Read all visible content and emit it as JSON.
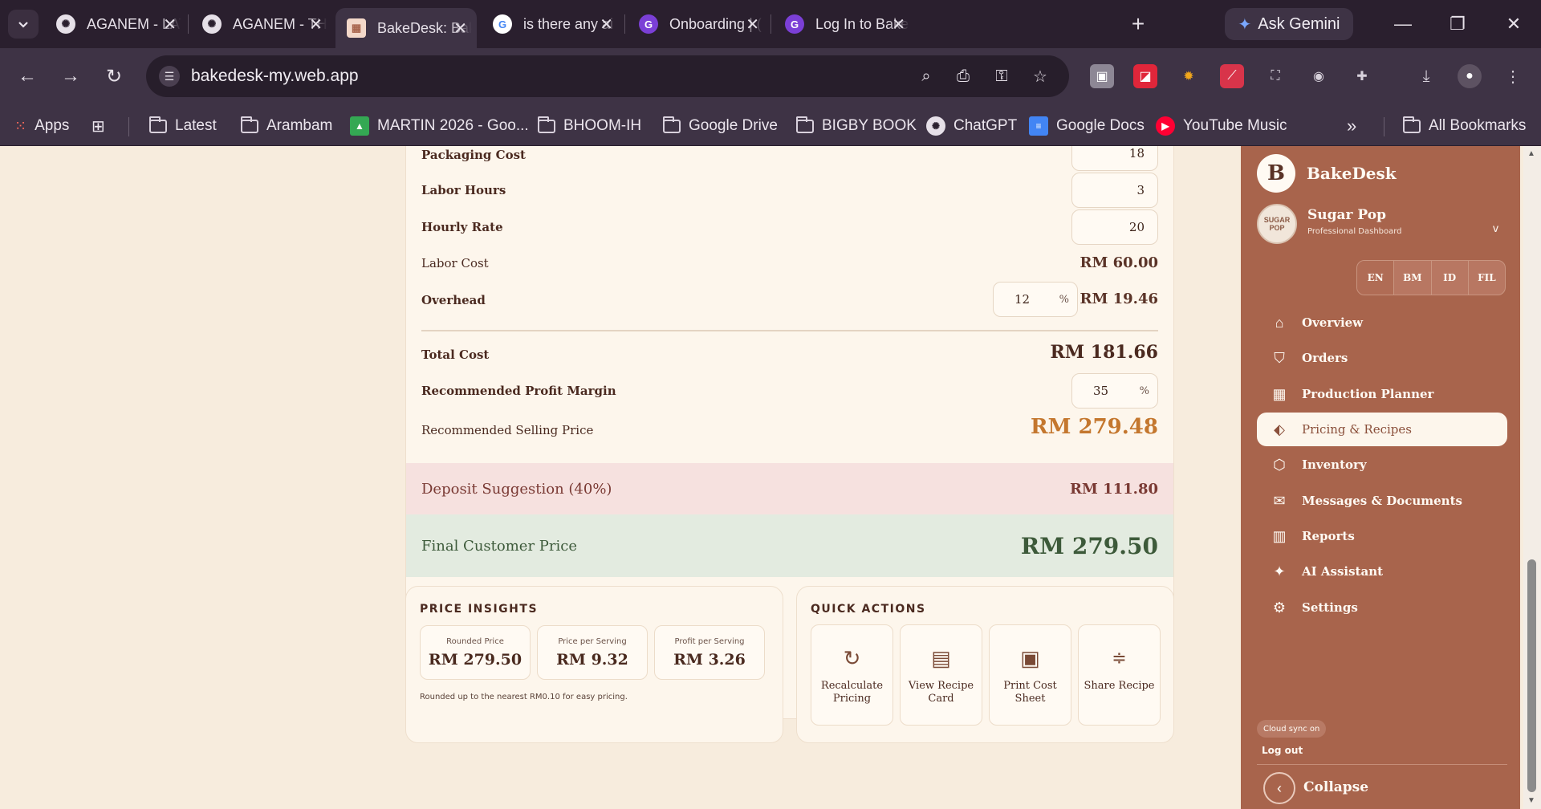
{
  "browser": {
    "tabs": [
      {
        "title": "AGANEM - LAT",
        "icon": "chatgpt-icon"
      },
      {
        "title": "AGANEM - THI",
        "icon": "chatgpt-icon"
      },
      {
        "title": "BakeDesk: Bak",
        "icon": "bakedesk-icon",
        "active": true
      },
      {
        "title": "is there any ai",
        "icon": "google-icon"
      },
      {
        "title": "Onboarding | (",
        "icon": "g-purple-icon"
      },
      {
        "title": "Log In to Bake",
        "icon": "g-purple-icon"
      }
    ],
    "ask_gemini": "Ask Gemini",
    "url": "bakedesk-my.web.app",
    "bookmarks": {
      "apps": "Apps",
      "latest": "Latest",
      "arambam": "Arambam",
      "martin": "MARTIN 2026 - Goo...",
      "bhoom": "BHOOM-IH",
      "google_drive": "Google Drive",
      "bigby": "BIGBY BOOK",
      "chatgpt": "ChatGPT",
      "google_docs": "Google Docs",
      "youtube_music": "YouTube Music",
      "more": "»",
      "all_bookmarks": "All Bookmarks"
    }
  },
  "calculator": {
    "packaging_cost": {
      "label": "Packaging Cost",
      "value": "18"
    },
    "labor_hours": {
      "label": "Labor Hours",
      "value": "3"
    },
    "hourly_rate": {
      "label": "Hourly Rate",
      "value": "20"
    },
    "labor_cost": {
      "label": "Labor Cost",
      "value": "RM 60.00"
    },
    "overhead": {
      "label": "Overhead",
      "percent": "12",
      "percent_symbol": "%",
      "value": "RM 19.46"
    },
    "total_cost": {
      "label": "Total Cost",
      "value": "RM 181.66"
    },
    "profit_margin": {
      "label": "Recommended Profit Margin",
      "percent": "35",
      "percent_symbol": "%"
    },
    "selling_price": {
      "label": "Recommended Selling Price",
      "value": "RM 279.48"
    },
    "deposit": {
      "label": "Deposit Suggestion (40%)",
      "value": "RM 111.80"
    },
    "final_price": {
      "label": "Final Customer Price",
      "value": "RM 279.50"
    }
  },
  "insights": {
    "title": "PRICE INSIGHTS",
    "rounded": {
      "caption": "Rounded Price",
      "value": "RM 279.50"
    },
    "per_serving": {
      "caption": "Price per Serving",
      "value": "RM 9.32"
    },
    "profit_serving": {
      "caption": "Profit per Serving",
      "value": "RM 3.26"
    },
    "note": "Rounded up to the nearest RM0.10 for easy pricing."
  },
  "quick_actions": {
    "title": "QUICK ACTIONS",
    "recalculate": "Recalculate Pricing",
    "view_card": "View Recipe Card",
    "print_sheet": "Print Cost Sheet",
    "share": "Share Recipe"
  },
  "sidebar": {
    "brand_letter": "B",
    "brand": "BakeDesk",
    "business_name": "Sugar Pop",
    "business_sub": "Professional Dashboard",
    "avatar_text": "SUGAR POP",
    "languages": [
      "EN",
      "BM",
      "ID",
      "FIL"
    ],
    "nav": [
      {
        "label": "Overview",
        "icon": "home-icon"
      },
      {
        "label": "Orders",
        "icon": "bag-icon"
      },
      {
        "label": "Production Planner",
        "icon": "calendar-icon"
      },
      {
        "label": "Pricing & Recipes",
        "icon": "tag-icon",
        "active": true
      },
      {
        "label": "Inventory",
        "icon": "box-icon"
      },
      {
        "label": "Messages & Documents",
        "icon": "mail-icon"
      },
      {
        "label": "Reports",
        "icon": "bar-chart-icon"
      },
      {
        "label": "AI Assistant",
        "icon": "sparkle-icon"
      },
      {
        "label": "Settings",
        "icon": "gear-icon"
      }
    ],
    "sync": "Cloud sync on",
    "logout": "Log out",
    "collapse": "Collapse"
  },
  "colors": {
    "sidebar_bg": "#a8644c",
    "accent_price": "#c4772e",
    "deposit_bg": "#f6e1df",
    "final_bg": "#e3ebe0",
    "final_text": "#3d5a3a"
  }
}
